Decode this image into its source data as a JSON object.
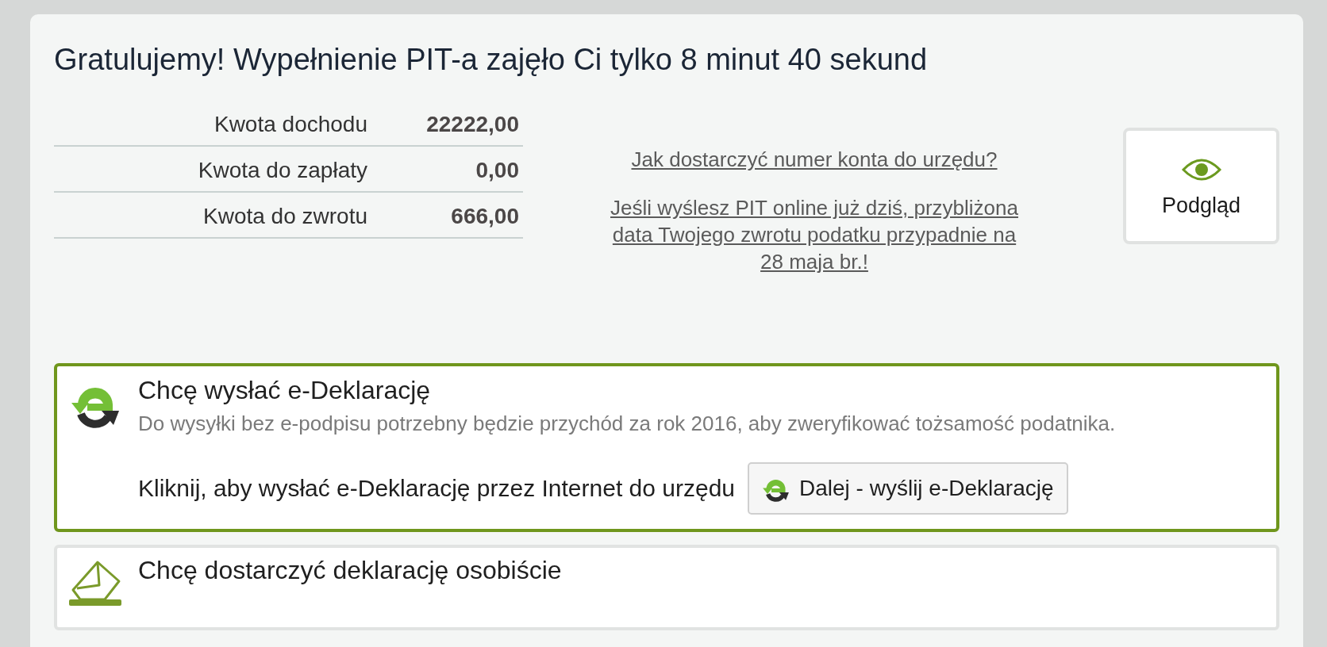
{
  "title": "Gratulujemy! Wypełnienie PIT-a zajęło Ci tylko 8 minut 40 sekund",
  "summary": {
    "rows": [
      {
        "label": "Kwota dochodu",
        "value": "22222,00"
      },
      {
        "label": "Kwota do zapłaty",
        "value": "0,00"
      },
      {
        "label": "Kwota do zwrotu",
        "value": "666,00"
      }
    ]
  },
  "links": [
    "Jak dostarczyć numer konta do urzędu?",
    "Jeśli wyślesz PIT online już dziś, przybliżona data Twojego zwrotu podatku przypadnie na 28 maja br.!"
  ],
  "preview_button": {
    "label": "Podgląd"
  },
  "options": [
    {
      "kind": "e-declaration",
      "selected": true,
      "title": "Chcę wysłać e-Deklarację",
      "note": "Do wysyłki bez e-podpisu potrzebny będzie przychód za rok 2016, aby zweryfikować tożsamość podatnika.",
      "action_text": "Kliknij, aby wysłać e-Deklarację przez Internet do urzędu",
      "action_button": "Dalej - wyślij e-Deklarację"
    },
    {
      "kind": "in-person",
      "selected": false,
      "title": "Chcę dostarczyć deklarację osobiście"
    }
  ]
}
